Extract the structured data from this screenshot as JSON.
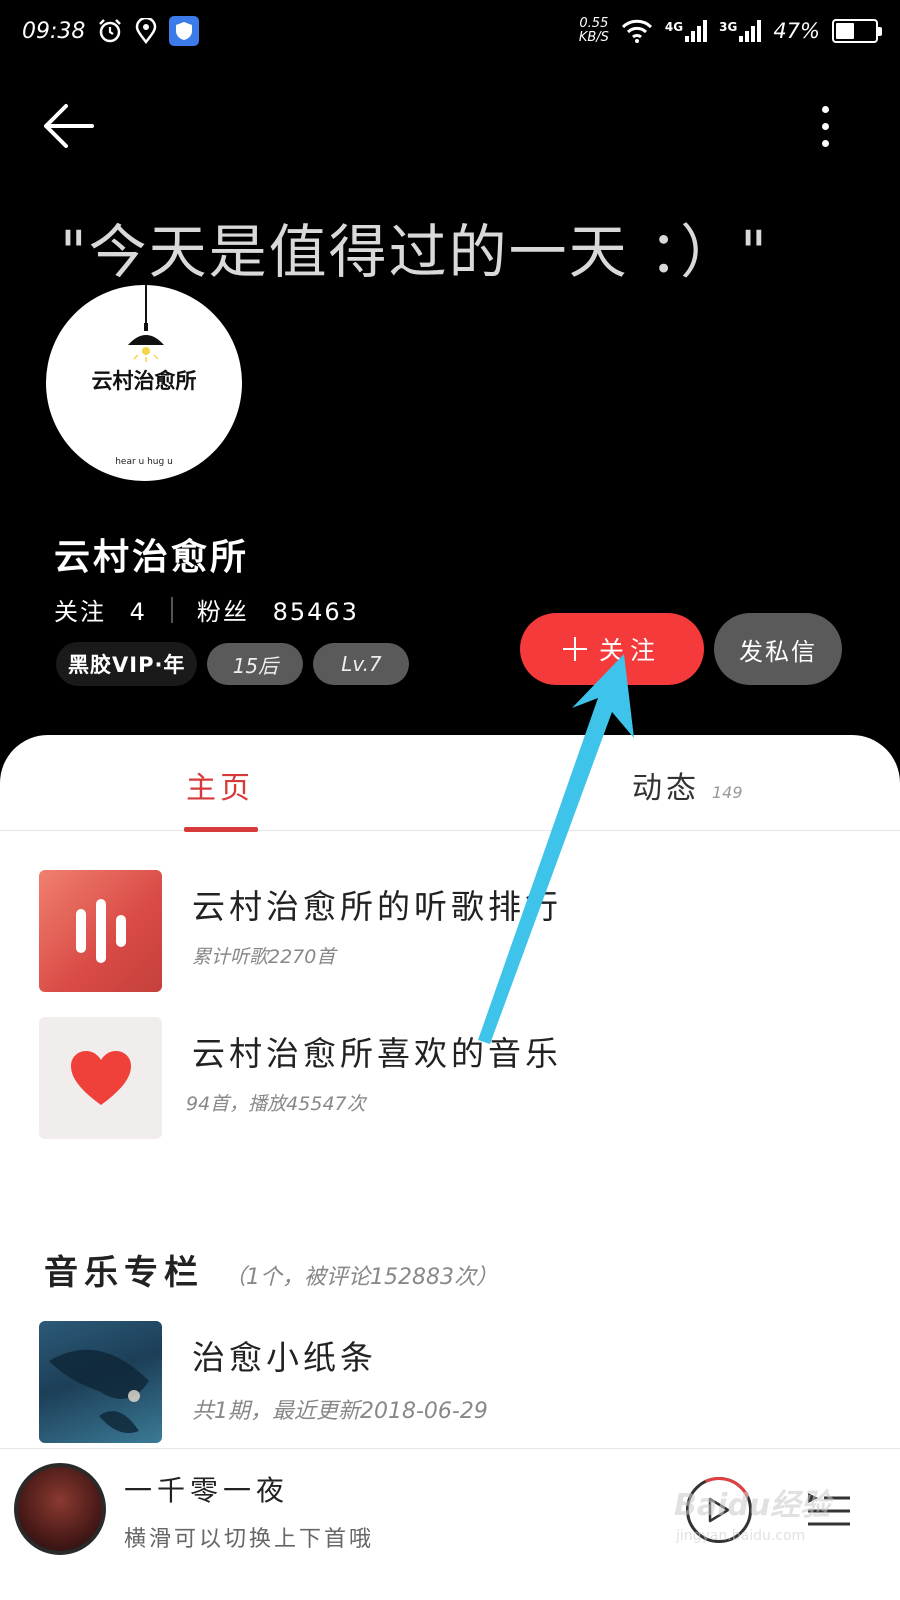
{
  "status_bar": {
    "time": "09:38",
    "net_speed_value": "0.55",
    "net_speed_unit": "KB/S",
    "net1": "4G",
    "net2": "3G",
    "battery": "47%",
    "battery_level": 0.47
  },
  "header": {
    "signature": "\"今天是值得过的一天 ：）\""
  },
  "profile": {
    "avatar_text": "云村治愈所",
    "avatar_subtext": "hear u   hug u",
    "name": "云村治愈所",
    "following_label": "关注",
    "following_count": "4",
    "followers_label": "粉丝",
    "followers_count": "85463",
    "vip_badge": "黑胶VIP·年",
    "age_tag": "15后",
    "level_tag": "Lv.7"
  },
  "actions": {
    "follow_label": "关注",
    "message_label": "发私信"
  },
  "tabs": {
    "home": "主页",
    "feed": "动态",
    "feed_count": "149"
  },
  "list": [
    {
      "title": "云村治愈所的听歌排行",
      "subtitle": "累计听歌2270首",
      "icon": "ranking-bars-icon"
    },
    {
      "title": "云村治愈所喜欢的音乐",
      "subtitle": "94首，播放45547次",
      "icon": "heart-icon"
    }
  ],
  "section": {
    "title": "音乐专栏",
    "meta": "（1个，被评论152883次）"
  },
  "column": {
    "title": "治愈小纸条",
    "subtitle": "共1期，最近更新2018-06-29"
  },
  "player": {
    "title": "一千零一夜",
    "subtitle": "横滑可以切换上下首哦"
  },
  "watermark": {
    "brand": "Baidu经验",
    "url": "jingyan.baidu.com"
  },
  "colors": {
    "accent": "#f43a3a",
    "tab_active": "#d63a3a",
    "annotation_arrow": "#3ec3ea"
  }
}
